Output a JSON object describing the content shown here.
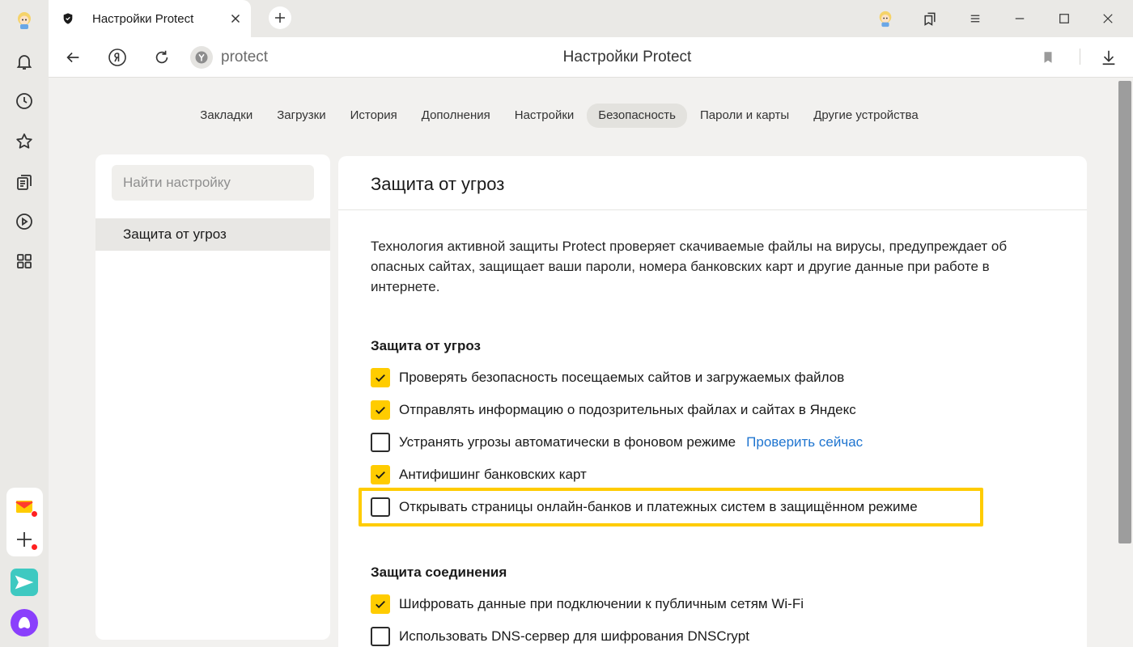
{
  "tab": {
    "title": "Настройки Protect"
  },
  "toolbar": {
    "address": "protect",
    "page_title": "Настройки Protect"
  },
  "nav": {
    "items": [
      "Закладки",
      "Загрузки",
      "История",
      "Дополнения",
      "Настройки",
      "Безопасность",
      "Пароли и карты",
      "Другие устройства"
    ],
    "active": "Безопасность"
  },
  "left_panel": {
    "search_placeholder": "Найти настройку",
    "selected_item": "Защита от угроз"
  },
  "main": {
    "title": "Защита от угроз",
    "description": "Технология активной защиты Protect проверяет скачиваемые файлы на вирусы, предупреждает об опасных сайтах, защищает ваши пароли, номера банковских карт и другие данные при работе в интернете.",
    "sections": [
      {
        "heading": "Защита от угроз",
        "options": [
          {
            "label": "Проверять безопасность посещаемых сайтов и загружаемых файлов",
            "checked": true
          },
          {
            "label": "Отправлять информацию о подозрительных файлах и сайтах в Яндекс",
            "checked": true
          },
          {
            "label": "Устранять угрозы автоматически в фоновом режиме",
            "checked": false,
            "link": "Проверить сейчас"
          },
          {
            "label": "Антифишинг банковских карт",
            "checked": true
          },
          {
            "label": "Открывать страницы онлайн-банков и платежных систем в защищённом режиме",
            "checked": false,
            "highlighted": true
          }
        ]
      },
      {
        "heading": "Защита соединения",
        "options": [
          {
            "label": "Шифровать данные при подключении к публичным сетям Wi-Fi",
            "checked": true
          },
          {
            "label": "Использовать DNS-сервер для шифрования DNSCrypt",
            "checked": false
          }
        ]
      }
    ]
  },
  "colors": {
    "accent": "#ffcc00",
    "link": "#1f75d0",
    "notification_dot": "#ff2020"
  },
  "icons": [
    "avatar-icon",
    "bell-icon",
    "history-icon",
    "star-icon",
    "collections-icon",
    "play-icon",
    "apps-icon",
    "mail-icon",
    "add-icon",
    "messenger-icon",
    "alice-icon",
    "shield-icon",
    "close-icon",
    "plus-icon",
    "back-icon",
    "yandex-icon",
    "reload-icon",
    "protect-badge-icon",
    "bookmark-icon",
    "download-icon",
    "collections-tabs-icon",
    "menu-icon",
    "minimize-icon",
    "maximize-icon",
    "window-close-icon",
    "checkmark-icon"
  ]
}
